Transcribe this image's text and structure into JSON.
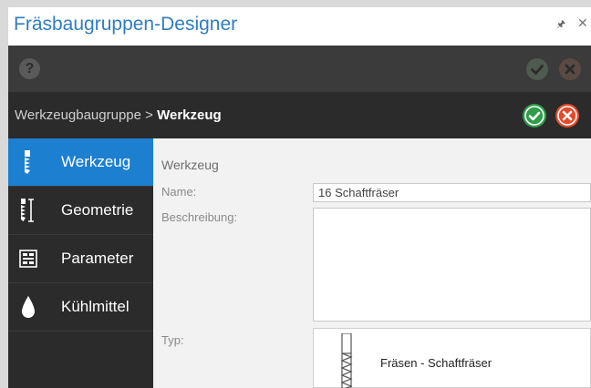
{
  "window": {
    "title": "Fräsbaugruppen-Designer",
    "pin_icon": "pin-icon",
    "close_icon": "close-icon"
  },
  "toolbar": {
    "help_label": "?",
    "icons": [
      "help-icon",
      "ok-icon",
      "cancel-icon"
    ]
  },
  "breadcrumb": {
    "parent": "Werkzeugbaugruppe",
    "separator": " > ",
    "current": "Werkzeug"
  },
  "sidebar": {
    "items": [
      {
        "label": "Werkzeug",
        "icon": "endmill-icon",
        "active": true
      },
      {
        "label": "Geometrie",
        "icon": "geometry-icon",
        "active": false
      },
      {
        "label": "Parameter",
        "icon": "parameter-icon",
        "active": false
      },
      {
        "label": "Kühlmittel",
        "icon": "coolant-drop-icon",
        "active": false
      }
    ]
  },
  "main": {
    "section_title": "Werkzeug",
    "name_label": "Name:",
    "name_value": "16 Schaftfräser",
    "description_label": "Beschreibung:",
    "description_value": "",
    "type_label": "Typ:",
    "type_value": "Fräsen - Schaftfräser"
  },
  "colors": {
    "accent": "#1d7fd0",
    "title": "#2f7dc0",
    "ok": "#2e9c48",
    "cancel": "#e24a2a",
    "dark": "#2b2b2b"
  }
}
